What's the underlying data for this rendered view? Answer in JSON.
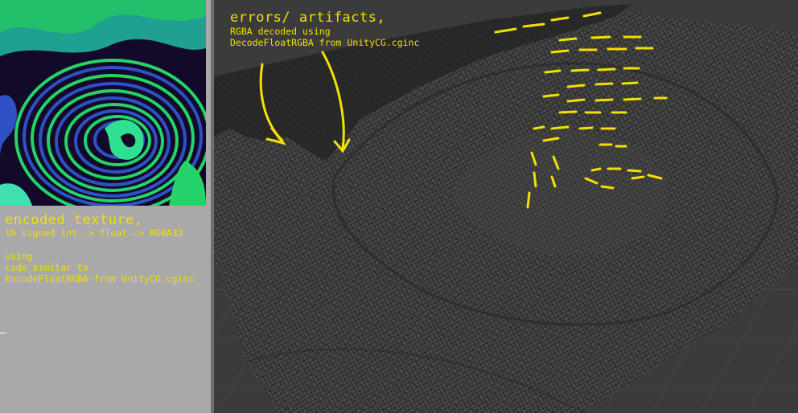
{
  "encoded_texture": {
    "title": "encoded texture,",
    "lines": [
      "16 signed int -> float -> RGBA32",
      "",
      "using",
      "code similar to",
      "EncodeFloatRGBA from UnityCG.cginc"
    ]
  },
  "artifacts_note": {
    "title": "errors/ artifacts,",
    "lines": [
      "RGBA decoded using",
      "DecodeFloatRGBA from UnityCG.cginc"
    ]
  },
  "colors": {
    "annotation": "#f2e000",
    "panel_background": "#a9a9a9",
    "viewport_background": "#3b3b3b",
    "mesh_fill": "#4a4a4a",
    "mesh_line": "#1a1a1a",
    "texture_green": "#24d36a",
    "texture_blue": "#3050c8",
    "texture_dark": "#120a28"
  }
}
